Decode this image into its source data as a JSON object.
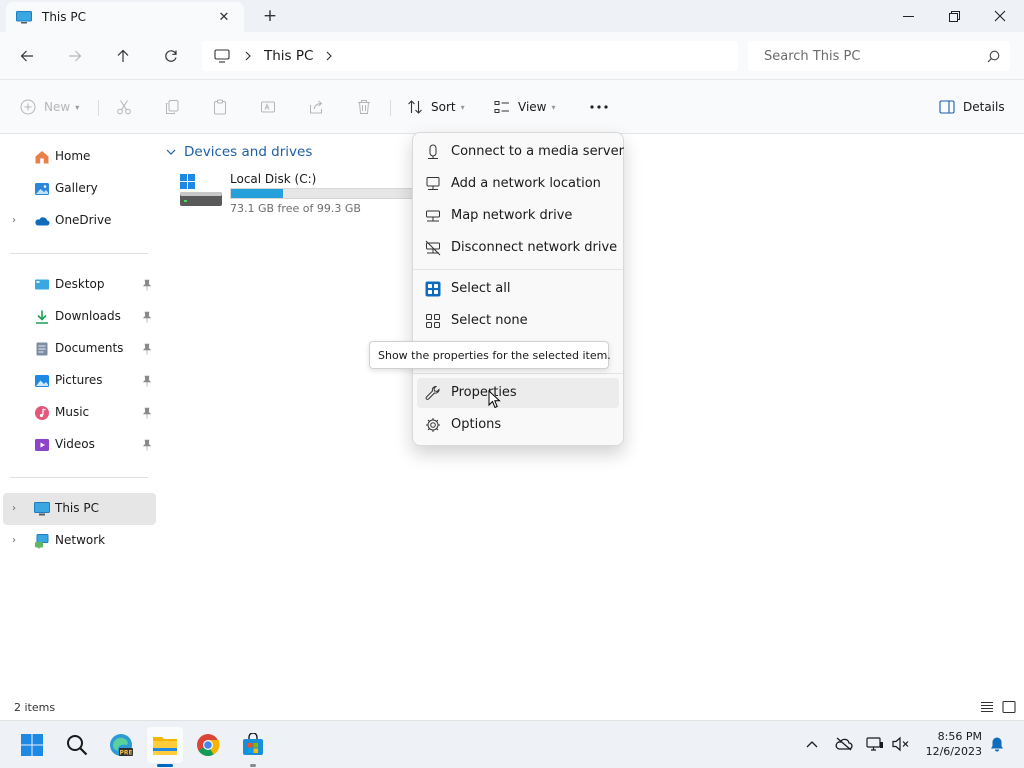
{
  "window": {
    "tab_title": "This PC",
    "new_tab": "+"
  },
  "address": {
    "crumb_current": "This PC",
    "search_placeholder": "Search This PC"
  },
  "toolbar": {
    "new_label": "New",
    "sort_label": "Sort",
    "view_label": "View",
    "more_label": "...",
    "details_label": "Details"
  },
  "sidebar": {
    "items": [
      {
        "label": "Home",
        "icon": "home-icon"
      },
      {
        "label": "Gallery",
        "icon": "gallery-icon"
      },
      {
        "label": "OneDrive",
        "icon": "onedrive-icon"
      },
      {
        "label": "Desktop",
        "icon": "desktop-icon",
        "pinned": true
      },
      {
        "label": "Downloads",
        "icon": "downloads-icon",
        "pinned": true
      },
      {
        "label": "Documents",
        "icon": "documents-icon",
        "pinned": true
      },
      {
        "label": "Pictures",
        "icon": "pictures-icon",
        "pinned": true
      },
      {
        "label": "Music",
        "icon": "music-icon",
        "pinned": true
      },
      {
        "label": "Videos",
        "icon": "videos-icon",
        "pinned": true
      },
      {
        "label": "This PC",
        "icon": "this-pc-icon",
        "selected": true
      },
      {
        "label": "Network",
        "icon": "network-icon"
      }
    ]
  },
  "content": {
    "group_title": "Devices and drives",
    "drive": {
      "name": "Local Disk (C:)",
      "free_text": "73.1 GB free of 99.3 GB",
      "used_fraction": 0.264
    }
  },
  "menu": {
    "items": [
      {
        "label": "Connect to a media server",
        "icon": "media-server-icon"
      },
      {
        "label": "Add a network location",
        "icon": "network-location-icon"
      },
      {
        "label": "Map network drive",
        "icon": "map-drive-icon"
      },
      {
        "label": "Disconnect network drive",
        "icon": "disconnect-drive-icon"
      },
      {
        "label": "Select all",
        "icon": "select-all-icon"
      },
      {
        "label": "Select none",
        "icon": "select-none-icon"
      },
      {
        "label": "Properties",
        "icon": "properties-icon"
      },
      {
        "label": "Options",
        "icon": "options-icon"
      }
    ]
  },
  "tooltip": "Show the properties for the selected item.",
  "status": {
    "items_count": "2 items"
  },
  "taskbar": {
    "time": "8:56 PM",
    "date": "12/6/2023"
  },
  "colors": {
    "accent": "#0067c0",
    "drive_fill": "#26a0da",
    "group_header": "#1f5fa6"
  }
}
